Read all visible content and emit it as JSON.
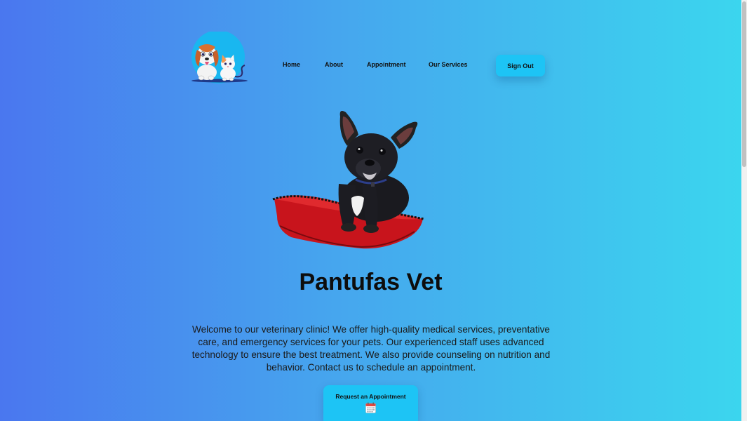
{
  "header": {
    "logo_icon": "dog-and-cat-logo-icon",
    "nav": {
      "home": "Home",
      "about": "About",
      "appointment": "Appointment",
      "services": "Our Services"
    },
    "sign_out": "Sign Out"
  },
  "hero": {
    "image_icon": "french-bulldog-on-red-cushion-image",
    "title": "Pantufas Vet",
    "description": "Welcome to our veterinary clinic! We offer high-quality medical services, preventative care, and emergency services for your pets. Our experienced staff uses advanced technology to ensure the best treatment. We also provide counseling on nutrition and behavior. Contact us to schedule an appointment.",
    "cta_label": "Request an Appointment",
    "cta_icon": "calendar-icon"
  },
  "colors": {
    "accent": "#1dc4f5",
    "gradient_start": "#4a77ef",
    "gradient_end": "#3bd6ee"
  }
}
